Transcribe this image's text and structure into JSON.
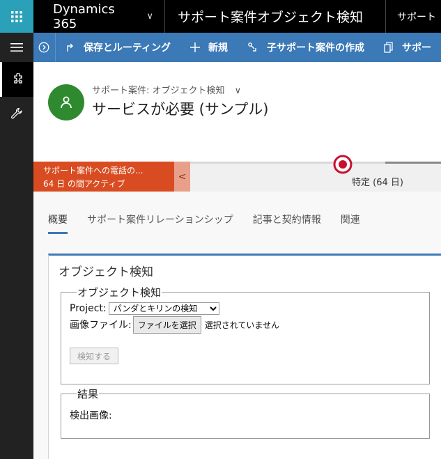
{
  "topbar": {
    "app_name": "Dynamics 365",
    "app_chevron": "∨",
    "entity_title": "サポート案件オブジェクト検知",
    "area_title": "サポート"
  },
  "commands": [
    {
      "label": "保存とルーティング",
      "icon": "route-icon"
    },
    {
      "label": "新規",
      "icon": "plus-icon"
    },
    {
      "label": "子サポート案件の作成",
      "icon": "child-case-icon"
    },
    {
      "label": "サポー",
      "icon": "copy-icon"
    }
  ],
  "header": {
    "entity_label": "サポート案件: オブジェクト検知",
    "entity_chevron": "∨",
    "record_name": "サービスが必要 (サンプル)"
  },
  "process": {
    "alert_line1": "サポート案件への電話の...",
    "alert_line2": "64 日 の間アクティブ",
    "collapse_glyph": "<",
    "stage_label": "特定  (64 日)",
    "colors": {
      "alert": "#d94c22",
      "marker": "#c8102e"
    }
  },
  "tabs": [
    {
      "label": "概要",
      "active": true
    },
    {
      "label": "サポート案件リレーションシップ",
      "active": false
    },
    {
      "label": "記事と契約情報",
      "active": false
    },
    {
      "label": "関連",
      "active": false
    }
  ],
  "section": {
    "title": "オブジェクト検知",
    "detection": {
      "legend": "オブジェクト検知",
      "project_label": "Project:",
      "project_selected": "パンダとキリンの検知",
      "image_label": "画像ファイル:",
      "file_button": "ファイルを選択",
      "no_file": "選択されていません",
      "detect_button": "検知する"
    },
    "result": {
      "legend": "結果",
      "detected_label": "検出画像:"
    }
  },
  "colors": {
    "accent": "#3b79b7",
    "waffle": "#2aa1b8",
    "avatar": "#2f8a2f"
  }
}
